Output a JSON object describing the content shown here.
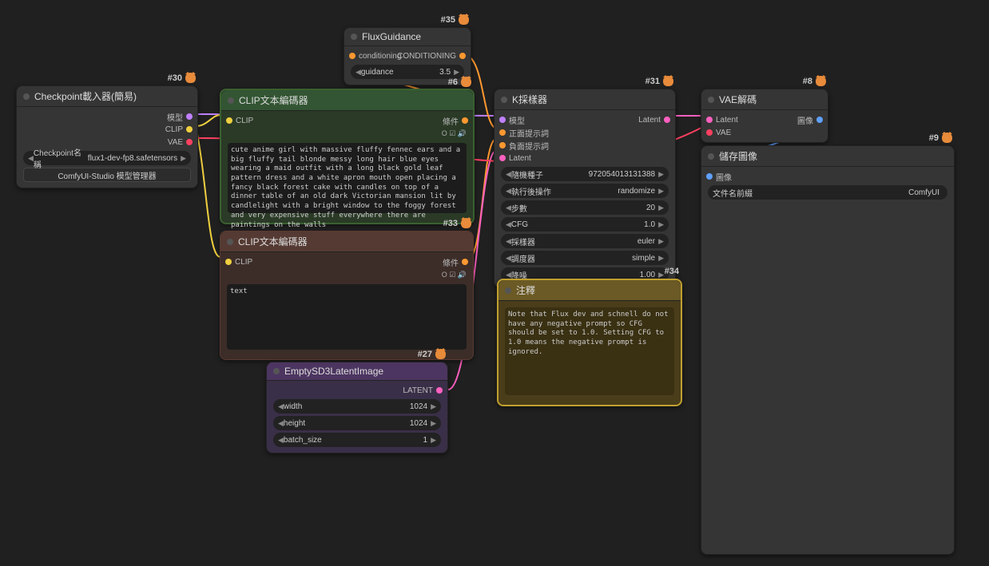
{
  "nodes": {
    "checkpoint": {
      "id": "#30",
      "title": "Checkpoint載入器(簡易)",
      "out": {
        "model": "模型",
        "clip": "CLIP",
        "vae": "VAE"
      },
      "ckpt_label": "Checkpoint名稱",
      "ckpt_value": "flux1-dev-fp8.safetensors",
      "manager_btn": "ComfyUI-Studio 模型管理器"
    },
    "fluxguidance": {
      "id": "#35",
      "title": "FluxGuidance",
      "in": "conditioning",
      "out": "CONDITIONING",
      "guidance_label": "guidance",
      "guidance_value": "3.5"
    },
    "clip_pos": {
      "id": "#6",
      "title": "CLIP文本編碼器",
      "in": "CLIP",
      "out": "條件",
      "toolbox": "O ☑ 🔊",
      "text": "cute anime girl with massive fluffy fennec ears and a big fluffy tail blonde messy long hair blue eyes wearing a maid outfit with a long black gold leaf pattern dress and a white apron mouth open placing a fancy black forest cake with candles on top of a dinner table of an old dark Victorian mansion lit by candlelight with a bright window to the foggy forest and very expensive stuff everywhere there are paintings on the walls"
    },
    "clip_neg": {
      "id": "#33",
      "title": "CLIP文本編碼器",
      "in": "CLIP",
      "out": "條件",
      "toolbox": "O ☑ 🔊",
      "text": "text"
    },
    "latent": {
      "id": "#27",
      "title": "EmptySD3LatentImage",
      "out": "LATENT",
      "width_label": "width",
      "width_value": "1024",
      "height_label": "height",
      "height_value": "1024",
      "batch_label": "batch_size",
      "batch_value": "1"
    },
    "ksampler": {
      "id": "#31",
      "title": "K採樣器",
      "in": {
        "model": "模型",
        "pos": "正面提示詞",
        "neg": "負面提示詞",
        "latent": "Latent"
      },
      "out": "Latent",
      "seed_label": "隨機種子",
      "seed_value": "972054013131388",
      "control_label": "執行後操作",
      "control_value": "randomize",
      "steps_label": "步數",
      "steps_value": "20",
      "cfg_label": "CFG",
      "cfg_value": "1.0",
      "sampler_label": "採樣器",
      "sampler_value": "euler",
      "scheduler_label": "調度器",
      "scheduler_value": "simple",
      "denoise_label": "降噪",
      "denoise_value": "1.00"
    },
    "note": {
      "id": "#34",
      "title": "注釋",
      "text": "Note that Flux dev and schnell do not have any negative prompt so CFG should be set to 1.0. Setting CFG to 1.0 means the negative prompt is ignored."
    },
    "vaedecode": {
      "id": "#8",
      "title": "VAE解碼",
      "in": {
        "latent": "Latent",
        "vae": "VAE"
      },
      "out": "圖像"
    },
    "save": {
      "id": "#9",
      "title": "儲存圖像",
      "in": "圖像",
      "prefix_label": "文件名前綴",
      "prefix_value": "ComfyUI"
    }
  }
}
